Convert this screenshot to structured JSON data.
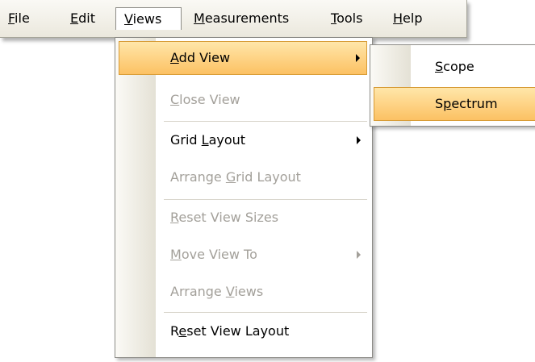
{
  "menubar": {
    "items": [
      {
        "label": "File",
        "mnemonic": "F",
        "rest": "ile"
      },
      {
        "label": "Edit",
        "mnemonic": "E",
        "rest": "dit"
      },
      {
        "label": "Views",
        "mnemonic": "V",
        "rest": "iews",
        "active": true
      },
      {
        "label": "Measurements",
        "mnemonic": "M",
        "rest": "easurements"
      },
      {
        "label": "Tools",
        "mnemonic": "T",
        "rest": "ools"
      },
      {
        "label": "Help",
        "mnemonic": "H",
        "rest": "elp"
      }
    ]
  },
  "views_menu": {
    "items": [
      {
        "label": "Add View",
        "pre": "",
        "mn": "A",
        "post": "dd View",
        "enabled": true,
        "highlighted": true,
        "submenu": true
      },
      {
        "label": "Close View",
        "pre": "",
        "mn": "C",
        "post": "lose View",
        "enabled": false,
        "submenu": false
      },
      {
        "label": "Grid Layout",
        "pre": "Grid ",
        "mn": "L",
        "post": "ayout",
        "enabled": true,
        "submenu": true
      },
      {
        "label": "Arrange Grid Layout",
        "pre": "Arrange ",
        "mn": "G",
        "post": "rid Layout",
        "enabled": false,
        "submenu": false
      },
      {
        "label": "Reset View Sizes",
        "pre": "",
        "mn": "R",
        "post": "eset View Sizes",
        "enabled": false,
        "submenu": false
      },
      {
        "label": "Move View To",
        "pre": "",
        "mn": "M",
        "post": "ove View To",
        "enabled": false,
        "submenu": true
      },
      {
        "label": "Arrange Views",
        "pre": "Arrange ",
        "mn": "V",
        "post": "iews",
        "enabled": false,
        "submenu": false
      },
      {
        "label": "Reset View Layout",
        "pre": "R",
        "mn": "e",
        "post": "set View Layout",
        "enabled": true,
        "submenu": false
      }
    ]
  },
  "add_view_submenu": {
    "items": [
      {
        "label": "Scope",
        "pre": "",
        "mn": "S",
        "post": "cope",
        "highlighted": false
      },
      {
        "label": "Spectrum",
        "pre": "S",
        "mn": "p",
        "post": "ectrum",
        "highlighted": true
      }
    ]
  },
  "colors": {
    "highlight_top": "#ffe6a9",
    "highlight_bottom": "#fcc163",
    "highlight_border": "#d79b35",
    "disabled_text": "#a3a09a",
    "menubar_bg": "#ebe8dd"
  }
}
